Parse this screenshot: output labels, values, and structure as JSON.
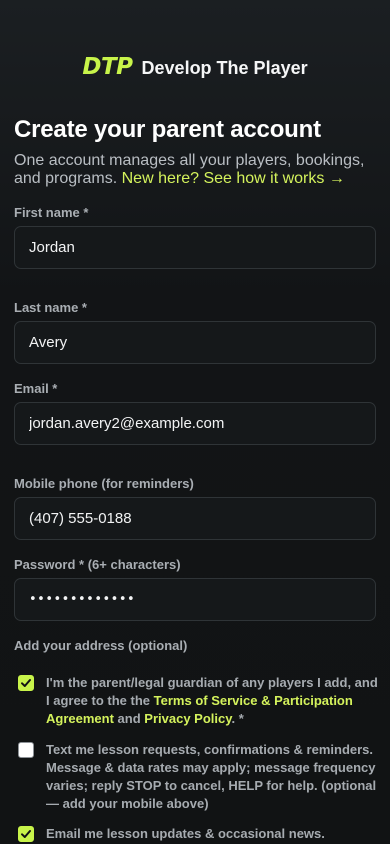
{
  "brand": {
    "logo": "DTP",
    "name": "Develop The Player"
  },
  "header": {
    "title": "Create your parent account",
    "subtitle": "One account manages all your players, bookings, and programs.",
    "how_link": "New here? See how it works →"
  },
  "form": {
    "first_name": {
      "label": "First name *",
      "value": "Jordan"
    },
    "last_name": {
      "label": "Last name *",
      "value": "Avery"
    },
    "email": {
      "label": "Email *",
      "value": "jordan.avery2@example.com"
    },
    "phone": {
      "label": "Mobile phone (for reminders)",
      "value": "(407) 555-0188"
    },
    "password": {
      "label": "Password * (6+ characters)",
      "value": "•••••••••••••"
    },
    "address_label": "Add your address (optional)"
  },
  "consents": {
    "terms": {
      "checked": true,
      "text_before": "I'm the parent/legal guardian of any players I add, and I agree to the",
      "terms_link": "Terms of Service & Participation Agreement",
      "and": "and",
      "privacy_link": "Privacy Policy",
      "text_after": ". *"
    },
    "sms": {
      "checked": false,
      "text": "Text me lesson requests, confirmations & reminders. Message & data rates may apply; message frequency varies; reply STOP to cancel, HELP for help. (optional — add your mobile above)"
    },
    "email_updates": {
      "checked": true,
      "text": "Email me lesson updates & occasional news."
    }
  },
  "colors": {
    "accent": "#c8f44a",
    "background": "#111314",
    "field": "#15181a"
  }
}
